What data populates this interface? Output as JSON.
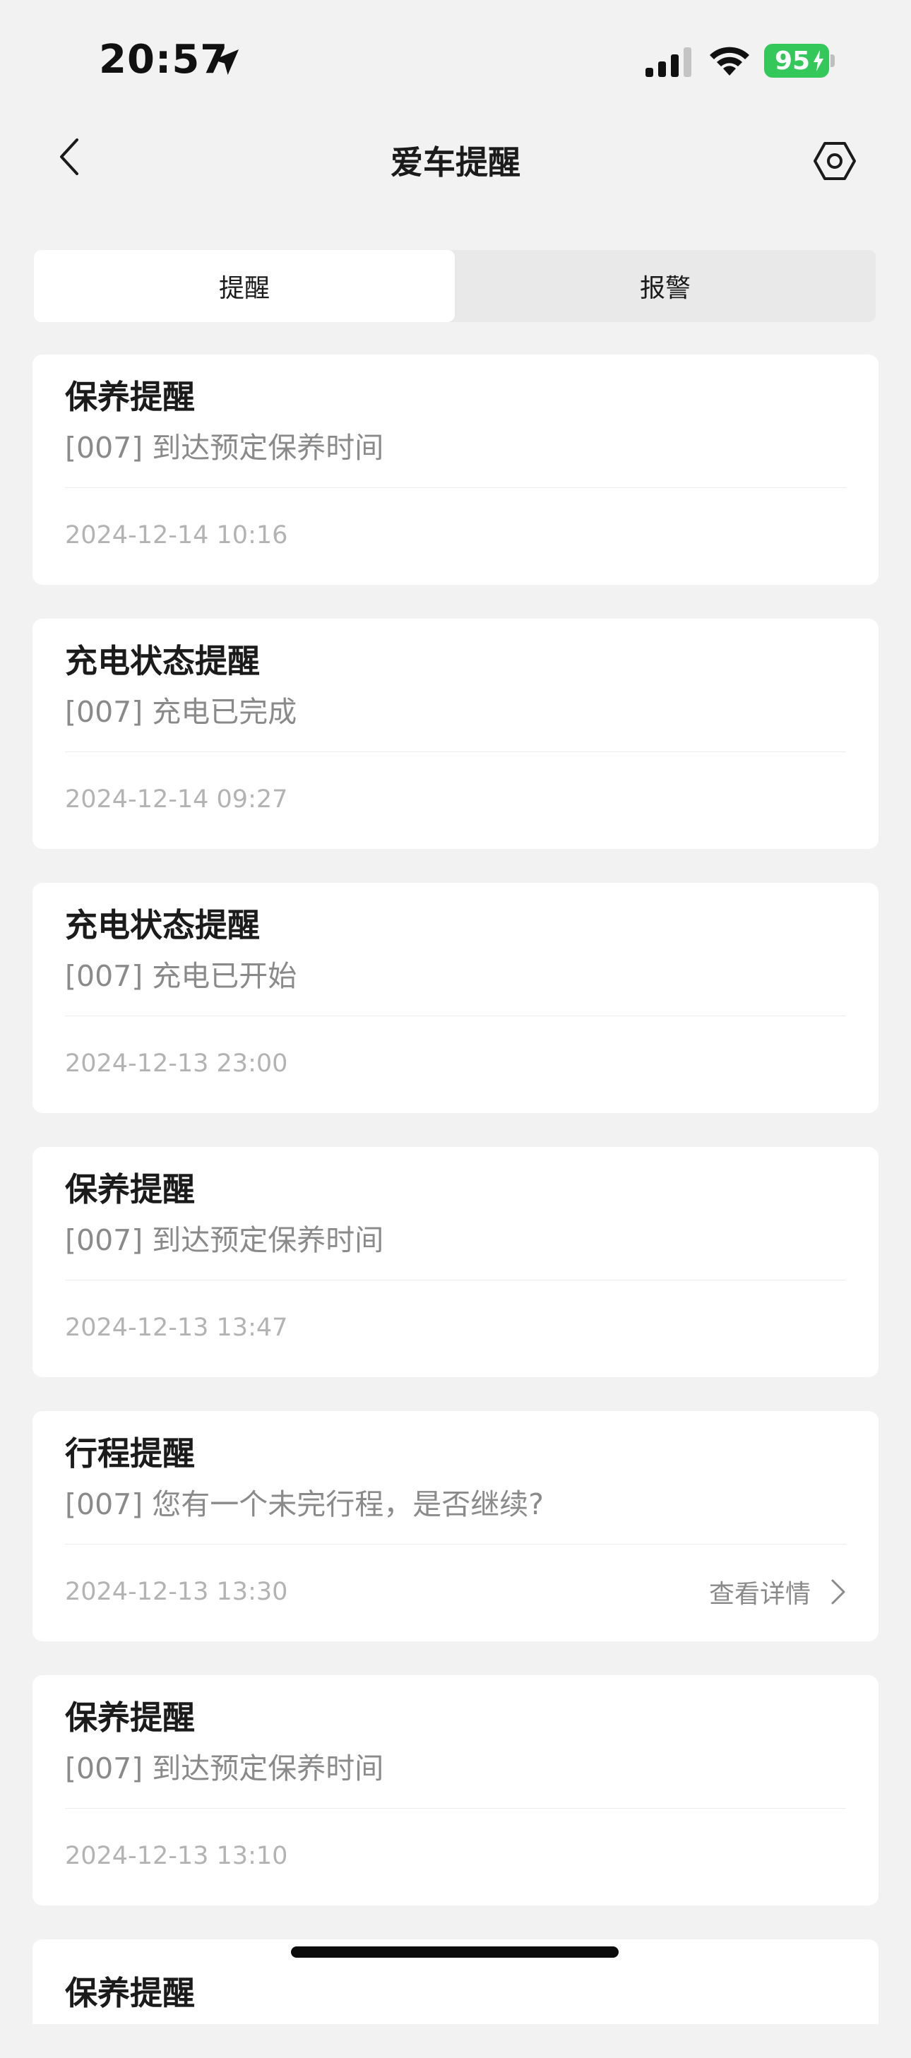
{
  "status_bar": {
    "time": "20:57",
    "battery": "95"
  },
  "nav": {
    "title": "爱车提醒"
  },
  "tabs": [
    {
      "label": "提醒",
      "active": true
    },
    {
      "label": "报警",
      "active": false
    }
  ],
  "cards": [
    {
      "title": "保养提醒",
      "message": "[007] 到达预定保养时间",
      "time": "2024-12-14 10:16"
    },
    {
      "title": "充电状态提醒",
      "message": "[007] 充电已完成",
      "time": "2024-12-14 09:27"
    },
    {
      "title": "充电状态提醒",
      "message": "[007] 充电已开始",
      "time": "2024-12-13 23:00"
    },
    {
      "title": "保养提醒",
      "message": "[007] 到达预定保养时间",
      "time": "2024-12-13 13:47"
    },
    {
      "title": "行程提醒",
      "message": "[007] 您有一个未完行程，是否继续?",
      "time": "2024-12-13 13:30",
      "detail_label": "查看详情"
    },
    {
      "title": "保养提醒",
      "message": "[007] 到达预定保养时间",
      "time": "2024-12-13 13:10"
    },
    {
      "title": "保养提醒"
    }
  ],
  "colors": {
    "battery": "#34c759",
    "background": "#f2f2f2",
    "card": "#ffffff",
    "muted_text": "#8a8a8a",
    "time_text": "#b3b3b3"
  }
}
